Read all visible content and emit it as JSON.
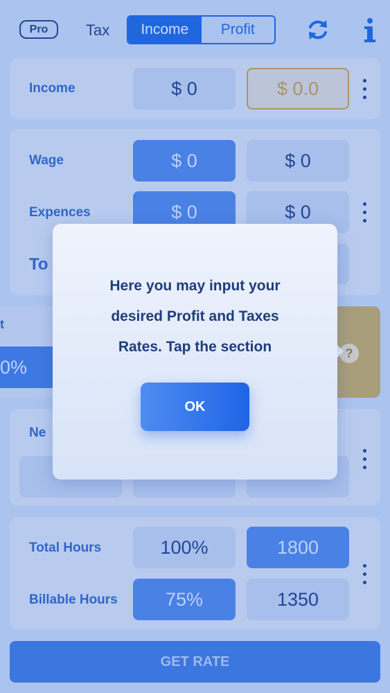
{
  "topbar": {
    "pro_badge": "Pro",
    "tax_label": "Tax",
    "tabs": [
      {
        "label": "Income",
        "active": true
      },
      {
        "label": "Profit",
        "active": false
      }
    ],
    "icons": [
      "refresh-icon",
      "info-icon"
    ]
  },
  "income_card": {
    "label": "Income",
    "value": "$ 0",
    "value_alt": "$ 0.0"
  },
  "wage_card": {
    "wage_label": "Wage",
    "wage_value": "$ 0",
    "wage_value_alt": "$ 0",
    "expences_label": "Expences",
    "expences_value": "$ 0",
    "expences_value_alt": "$ 0",
    "total_label_partial": "To"
  },
  "profit_tax_row": {
    "left_label_partial": "t",
    "left_value_partial": "0%"
  },
  "net_card": {
    "label_partial": "Ne"
  },
  "hours_card": {
    "total_label": "Total Hours",
    "total_percent": "100%",
    "total_value": "1800",
    "billable_label": "Billable Hours",
    "billable_percent": "75%",
    "billable_value": "1350"
  },
  "get_rate_button": "GET RATE",
  "dialog": {
    "message_line1": "Here you may input your",
    "message_line2": "desired Profit and Taxes",
    "message_line3": "Rates. Tap the section",
    "ok_label": "OK"
  },
  "help_icon_text": "?",
  "colors": {
    "accent": "#1b63e0",
    "card_bg": "#c8d7f2",
    "gold": "#b89955",
    "text_dark": "#1c3f8a"
  }
}
